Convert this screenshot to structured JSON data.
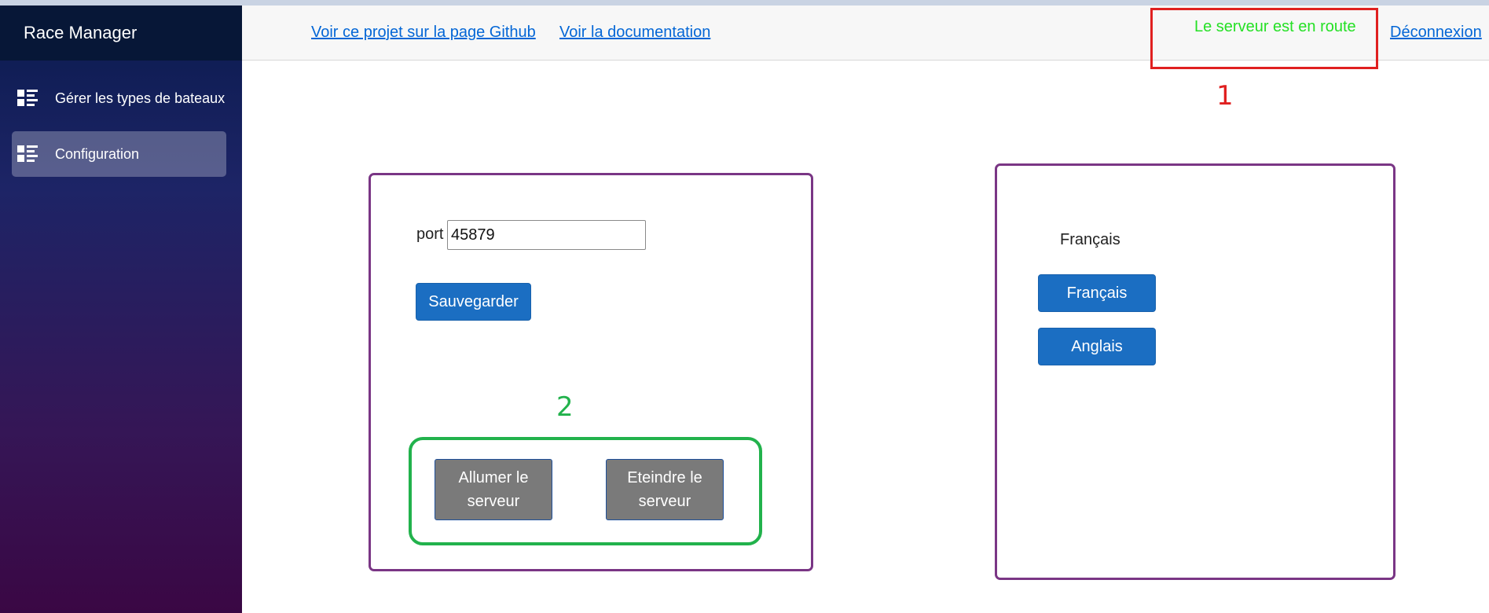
{
  "app": {
    "title": "Race Manager"
  },
  "sidebar": {
    "items": [
      {
        "label": "Gérer les types de bateaux",
        "icon": "list-icon",
        "active": false
      },
      {
        "label": "Configuration",
        "icon": "list-icon",
        "active": true
      }
    ]
  },
  "topbar": {
    "github_link": "Voir ce projet sur la page Github",
    "docs_link": "Voir la documentation",
    "server_status": "Le serveur est en route",
    "logout_link": "Déconnexion"
  },
  "annotations": {
    "marker_1": "1",
    "marker_2": "2"
  },
  "server_panel": {
    "port_label": "port",
    "port_value": "45879",
    "save_button": "Sauvegarder",
    "start_button": "Allumer le serveur",
    "stop_button": "Eteindre le serveur"
  },
  "language_panel": {
    "current_language": "Français",
    "french_button": "Français",
    "english_button": "Anglais"
  },
  "colors": {
    "accent_blue": "#1b6ec2",
    "status_green": "#25e025",
    "panel_border": "#7a3685",
    "annotation_red": "#e02020",
    "annotation_green": "#22b24c"
  }
}
